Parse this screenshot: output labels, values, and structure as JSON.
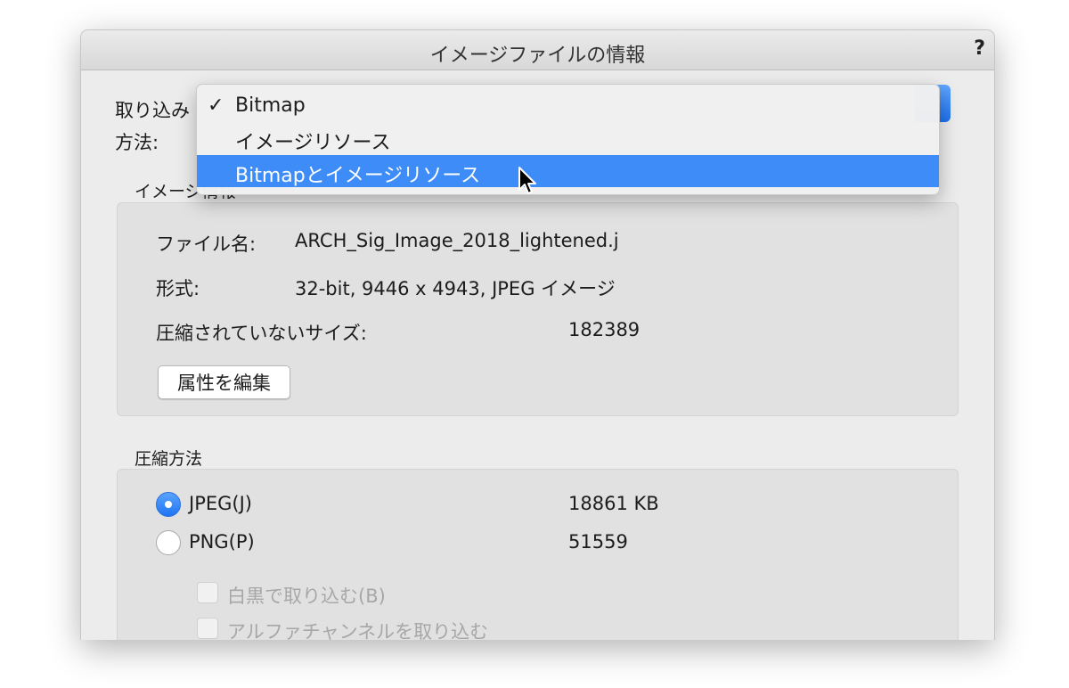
{
  "window": {
    "title": "イメージファイルの情報",
    "help": "?"
  },
  "import_method": {
    "label_line1": "取り込み",
    "label_line2": "方法:"
  },
  "menu": {
    "check_mark": "✓",
    "items": [
      {
        "label": "Bitmap",
        "checked": true,
        "highlighted": false
      },
      {
        "label": "イメージリソース",
        "checked": false,
        "highlighted": false
      },
      {
        "label": "Bitmapとイメージリソース",
        "checked": false,
        "highlighted": true
      }
    ]
  },
  "image_info": {
    "title": "イメージ情報",
    "filename_label": "ファイル名:",
    "filename_value": "ARCH_Sig_Image_2018_lightened.j",
    "format_label": "形式:",
    "format_value": "32-bit, 9446 x 4943, JPEG イメージ",
    "uncompressed_label": "圧縮されていないサイズ:",
    "uncompressed_value": "182389",
    "edit_button": "属性を編集"
  },
  "compression": {
    "title": "圧縮方法",
    "jpeg_label": "JPEG(J)",
    "jpeg_value": "18861 KB",
    "png_label": "PNG(P)",
    "png_value": "51559",
    "grayscale_label": "白黒で取り込む(B)",
    "alpha_label": "アルファチャンネルを取り込む"
  },
  "colors": {
    "accent": "#3e8cf7",
    "dialog_bg": "#ececec"
  }
}
